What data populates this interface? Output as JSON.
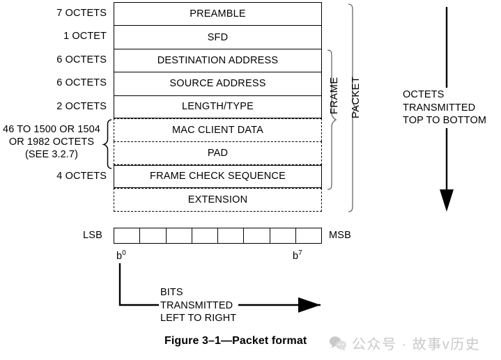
{
  "figure": {
    "caption": "Figure 3–1—Packet format"
  },
  "fields": [
    {
      "size": "7 OCTETS",
      "name": "PREAMBLE",
      "border": "solid"
    },
    {
      "size": "1 OCTET",
      "name": "SFD",
      "border": "solid"
    },
    {
      "size": "6 OCTETS",
      "name": "DESTINATION ADDRESS",
      "border": "solid"
    },
    {
      "size": "6 OCTETS",
      "name": "SOURCE ADDRESS",
      "border": "solid"
    },
    {
      "size": "2 OCTETS",
      "name": "LENGTH/TYPE",
      "border": "solid"
    },
    {
      "size": "",
      "name": "MAC CLIENT DATA",
      "border": "dashed"
    },
    {
      "size": "",
      "name": "PAD",
      "border": "dashed"
    },
    {
      "size": "4 OCTETS",
      "name": "FRAME CHECK SEQUENCE",
      "border": "solid"
    },
    {
      "size": "",
      "name": "EXTENSION",
      "border": "dashed"
    }
  ],
  "data_size_label": {
    "line1": "46 TO 1500 OR 1504",
    "line2": "OR 1982 OCTETS",
    "line3": "(SEE 3.2.7)"
  },
  "brackets": {
    "frame": "FRAME",
    "packet": "PACKET"
  },
  "notes": {
    "octets_transmitted": "OCTETS\nTRANSMITTED\nTOP TO BOTTOM",
    "bits_transmitted": "BITS\nTRANSMITTED\nLEFT TO RIGHT"
  },
  "bit_strip": {
    "lsb_label": "LSB",
    "msb_label": "MSB",
    "first_bit": "b",
    "first_bit_index": "0",
    "last_bit": "b",
    "last_bit_index": "7",
    "cells": [
      "",
      "",
      "",
      "",
      "",
      "",
      "",
      ""
    ]
  },
  "watermark": {
    "text": "公众号 · 故事v历史",
    "color": "#c9c9c9"
  },
  "colors": {
    "background": "#ffffff",
    "line": "#000000",
    "text": "#000000"
  }
}
